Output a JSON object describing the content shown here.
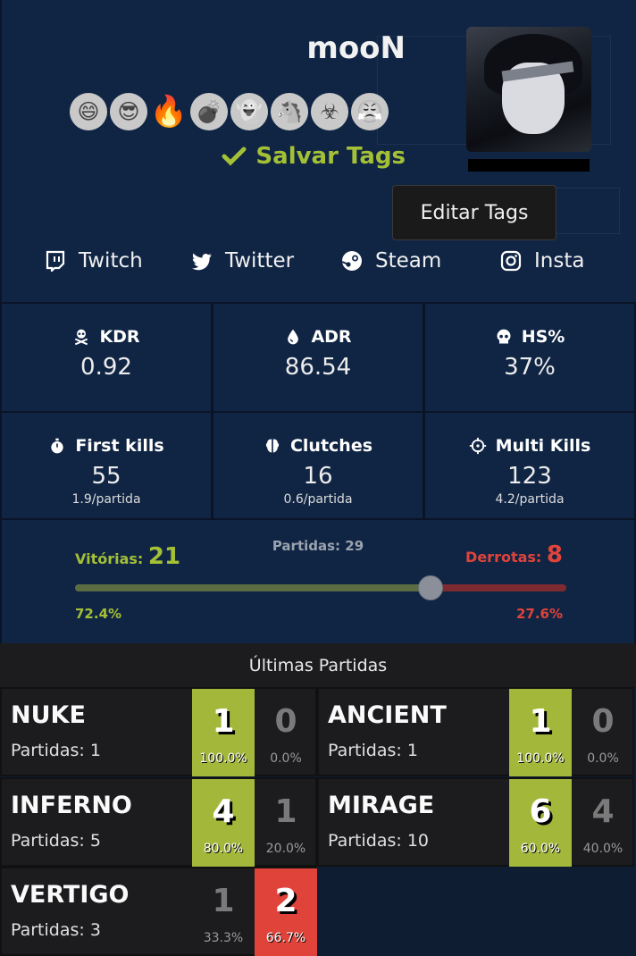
{
  "profile": {
    "name": "mooN",
    "emojis": [
      "😄",
      "😎",
      "🔥",
      "💣",
      "👻",
      "🐴",
      "☣",
      "😤"
    ],
    "save_tags_label": "Salvar Tags",
    "edit_tags_label": "Editar Tags"
  },
  "social": [
    {
      "label": "Twitch",
      "icon": "twitch-icon"
    },
    {
      "label": "Twitter",
      "icon": "twitter-icon"
    },
    {
      "label": "Steam",
      "icon": "steam-icon"
    },
    {
      "label": "Insta",
      "icon": "instagram-icon"
    }
  ],
  "stats": [
    {
      "label": "KDR",
      "value": "0.92",
      "icon": "skull-crossbones-icon"
    },
    {
      "label": "ADR",
      "value": "86.54",
      "icon": "drop-icon"
    },
    {
      "label": "HS%",
      "value": "37%",
      "icon": "skull-icon"
    },
    {
      "label": "First kills",
      "value": "55",
      "sub": "1.9/partida",
      "icon": "stopwatch-icon"
    },
    {
      "label": "Clutches",
      "value": "16",
      "sub": "0.6/partida",
      "icon": "brain-icon"
    },
    {
      "label": "Multi Kills",
      "value": "123",
      "sub": "4.2/partida",
      "icon": "crosshair-icon"
    }
  ],
  "record": {
    "wins_label": "Vitórias:",
    "wins": "21",
    "total_label": "Partidas: 29",
    "losses_label": "Derrotas:",
    "losses": "8",
    "win_pct": "72.4%",
    "loss_pct": "27.6%",
    "win_fraction": 0.724
  },
  "matches": {
    "title": "Últimas Partidas",
    "maps": [
      {
        "map": "NUKE",
        "plays": "Partidas: 1",
        "wins": "1",
        "win_pct": "100.0%",
        "losses": "0",
        "loss_pct": "0.0%",
        "hi": "win"
      },
      {
        "map": "ANCIENT",
        "plays": "Partidas: 1",
        "wins": "1",
        "win_pct": "100.0%",
        "losses": "0",
        "loss_pct": "0.0%",
        "hi": "win"
      },
      {
        "map": "INFERNO",
        "plays": "Partidas: 5",
        "wins": "4",
        "win_pct": "80.0%",
        "losses": "1",
        "loss_pct": "20.0%",
        "hi": "win"
      },
      {
        "map": "MIRAGE",
        "plays": "Partidas: 10",
        "wins": "6",
        "win_pct": "60.0%",
        "losses": "4",
        "loss_pct": "40.0%",
        "hi": "win"
      },
      {
        "map": "VERTIGO",
        "plays": "Partidas: 3",
        "wins": "1",
        "win_pct": "33.3%",
        "losses": "2",
        "loss_pct": "66.7%",
        "hi": "loss"
      }
    ]
  },
  "colors": {
    "accent_green": "#a3c036",
    "accent_red": "#e0433a",
    "bg_navy": "#102544"
  }
}
